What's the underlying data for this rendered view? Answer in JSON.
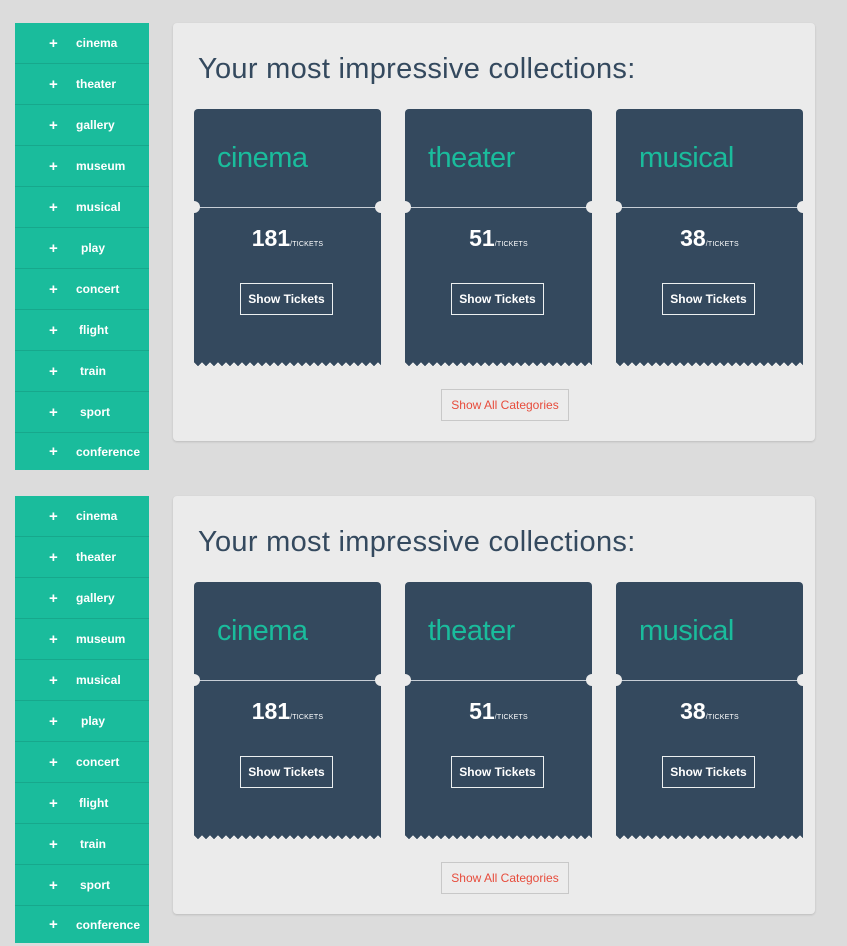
{
  "sections": [
    {
      "sidebar": {
        "items": [
          {
            "label": "cinema"
          },
          {
            "label": "theater"
          },
          {
            "label": "gallery"
          },
          {
            "label": "museum"
          },
          {
            "label": "musical"
          },
          {
            "label": "play"
          },
          {
            "label": "concert"
          },
          {
            "label": "flight"
          },
          {
            "label": "train"
          },
          {
            "label": "sport"
          },
          {
            "label": "conference"
          }
        ],
        "icon": "plus-icon",
        "icon_glyph": "+"
      },
      "panel": {
        "title": "Your most impressive collections:",
        "tickets": [
          {
            "name": "cinema",
            "count": "181",
            "unit": "/TICKETS",
            "button": "Show Tickets"
          },
          {
            "name": "theater",
            "count": "51",
            "unit": "/TICKETS",
            "button": "Show Tickets"
          },
          {
            "name": "musical",
            "count": "38",
            "unit": "/TICKETS",
            "button": "Show Tickets"
          }
        ],
        "show_all": "Show All Categories"
      }
    },
    {
      "sidebar": {
        "items": [
          {
            "label": "cinema"
          },
          {
            "label": "theater"
          },
          {
            "label": "gallery"
          },
          {
            "label": "museum"
          },
          {
            "label": "musical"
          },
          {
            "label": "play"
          },
          {
            "label": "concert"
          },
          {
            "label": "flight"
          },
          {
            "label": "train"
          },
          {
            "label": "sport"
          },
          {
            "label": "conference"
          }
        ],
        "icon": "plus-icon",
        "icon_glyph": "+"
      },
      "panel": {
        "title": "Your most impressive collections:",
        "tickets": [
          {
            "name": "cinema",
            "count": "181",
            "unit": "/TICKETS",
            "button": "Show Tickets"
          },
          {
            "name": "theater",
            "count": "51",
            "unit": "/TICKETS",
            "button": "Show Tickets"
          },
          {
            "name": "musical",
            "count": "38",
            "unit": "/TICKETS",
            "button": "Show Tickets"
          }
        ],
        "show_all": "Show All Categories"
      }
    }
  ],
  "colors": {
    "accent": "#1abc9c",
    "ticket_bg": "#34495e",
    "title": "#34495e",
    "show_all_text": "#e74c3c",
    "page_bg": "#dcdcdc",
    "panel_bg": "#ebebeb"
  }
}
